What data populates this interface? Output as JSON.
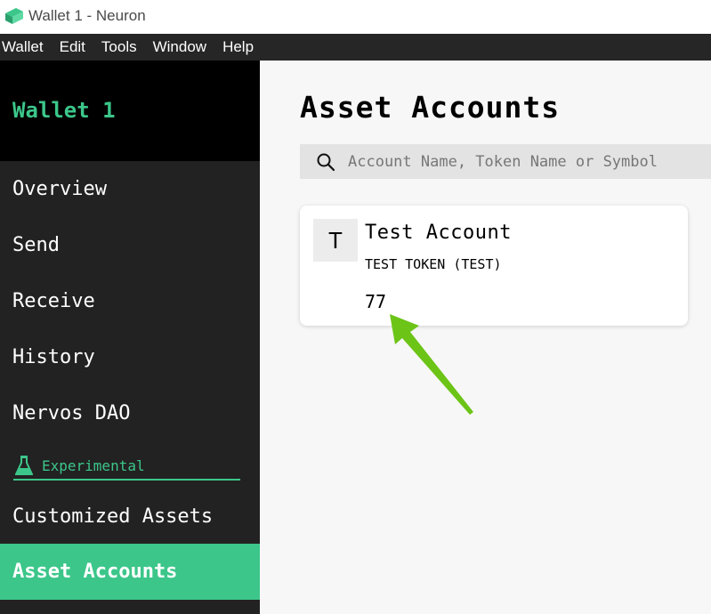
{
  "window": {
    "title": "Wallet 1 - Neuron"
  },
  "menu": {
    "items": [
      "Wallet",
      "Edit",
      "Tools",
      "Window",
      "Help"
    ]
  },
  "sidebar": {
    "wallet_name": "Wallet 1",
    "items": [
      {
        "label": "Overview"
      },
      {
        "label": "Send"
      },
      {
        "label": "Receive"
      },
      {
        "label": "History"
      },
      {
        "label": "Nervos DAO"
      }
    ],
    "experimental_label": "Experimental",
    "experimental_icon": "flask-icon",
    "experimental_items": [
      {
        "label": "Customized Assets"
      },
      {
        "label": "Asset Accounts",
        "active": true
      }
    ]
  },
  "main": {
    "title": "Asset Accounts",
    "search": {
      "placeholder": "Account Name, Token Name or Symbol",
      "value": "",
      "icon": "search-icon"
    },
    "accounts": [
      {
        "avatar": "T",
        "name": "Test Account",
        "token": "TEST TOKEN (TEST)",
        "balance": "77"
      }
    ]
  },
  "colors": {
    "accent": "#3cc68a",
    "sidebar_bg": "#222222",
    "annotation_arrow": "#6cc417"
  }
}
